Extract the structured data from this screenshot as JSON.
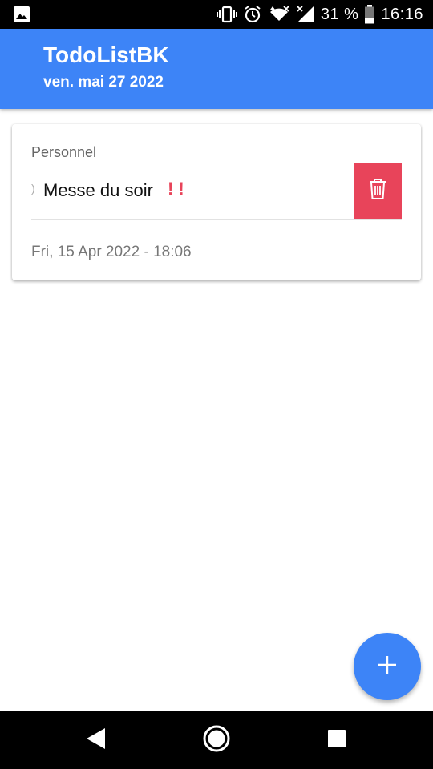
{
  "status_bar": {
    "battery_percent": "31 %",
    "time": "16:16",
    "icons": [
      "gallery-icon",
      "vibrate-icon",
      "alarm-icon",
      "wifi-icon",
      "signal-icon",
      "battery-icon"
    ]
  },
  "app_bar": {
    "title": "TodoListBK",
    "subtitle": "ven. mai 27 2022",
    "color": "#3d84f7"
  },
  "task": {
    "category": "Personnel",
    "handle": ")",
    "title": "Messe du soir",
    "priority": "!!",
    "datetime": "Fri, 15 Apr 2022 - 18:06",
    "delete_color": "#e8445a",
    "icons": [
      "trash-icon"
    ]
  },
  "fab": {
    "icon": "plus-icon",
    "color": "#3d84f7"
  },
  "nav_bar": {
    "icons": [
      "back-icon",
      "home-icon",
      "recents-icon"
    ]
  }
}
